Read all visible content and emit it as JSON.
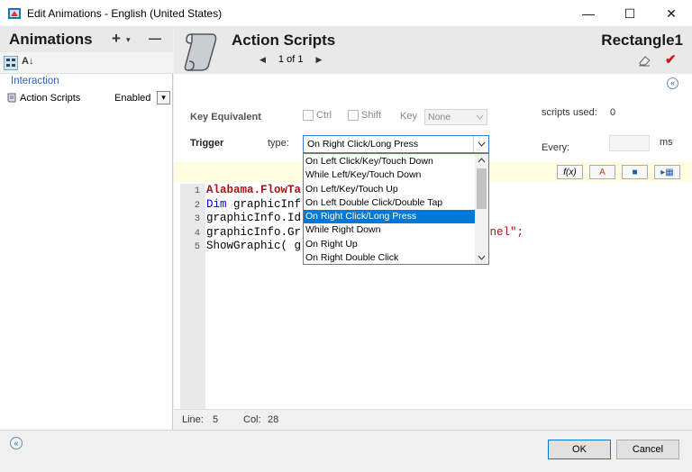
{
  "window": {
    "title": "Edit Animations - English (United States)",
    "minimize": "—",
    "maximize": "☐",
    "close": "✕"
  },
  "left": {
    "title": "Animations",
    "add_label": "+",
    "add_arrow": "▾",
    "remove_label": "—",
    "sort_label": "A↓",
    "section": "Interaction",
    "item": {
      "label": "Action Scripts",
      "state": "Enabled",
      "arrow": "▾"
    },
    "collapse_icon": "«"
  },
  "header": {
    "title": "Action Scripts",
    "pager": {
      "prev": "◀",
      "text": "1 of 1",
      "next": "▶"
    },
    "object": "Rectangle1",
    "check": "✔"
  },
  "form": {
    "collapse_icon": "«",
    "key_equivalent": "Key Equivalent",
    "ctrl": "Ctrl",
    "shift": "Shift",
    "key": "Key",
    "key_value": "None",
    "scripts_used_label": "scripts used:",
    "scripts_used": "0",
    "trigger": "Trigger",
    "type_label": "type:",
    "type_value": "On Right Click/Long Press",
    "every_label": "Every:",
    "ms": "ms"
  },
  "toolbar": {
    "fx": "f(x)",
    "b2": "A",
    "b3": "■",
    "b4": "▸▦"
  },
  "code": {
    "line_numbers": [
      "1",
      "2",
      "3",
      "4",
      "5"
    ],
    "lines": [
      {
        "a": "Alabama.FlowTa",
        "b": ""
      },
      {
        "a": "Dim",
        "b": " graphicInf"
      },
      {
        "a": "graphicInfo.Id",
        "b": ""
      },
      {
        "a": "graphicInfo.Gr",
        "b": "",
        "c": "anel\";"
      },
      {
        "a": "ShowGraphic( g",
        "b": ""
      }
    ]
  },
  "status": {
    "line_label": "Line:",
    "line": "5",
    "col_label": "Col:",
    "col": "28"
  },
  "dropdown": {
    "options": [
      "On Left Click/Key/Touch Down",
      "While Left/Key/Touch Down",
      "On Left/Key/Touch Up",
      "On Left Double Click/Double Tap",
      "On Right Click/Long Press",
      "While Right Down",
      "On Right Up",
      "On Right Double Click"
    ],
    "selected_index": 4
  },
  "buttons": {
    "ok": "OK",
    "cancel": "Cancel"
  },
  "colors": {
    "accent": "#0078d7",
    "keyword": "#0000ff",
    "identifier": "#a31515",
    "link": "#3065b5"
  }
}
